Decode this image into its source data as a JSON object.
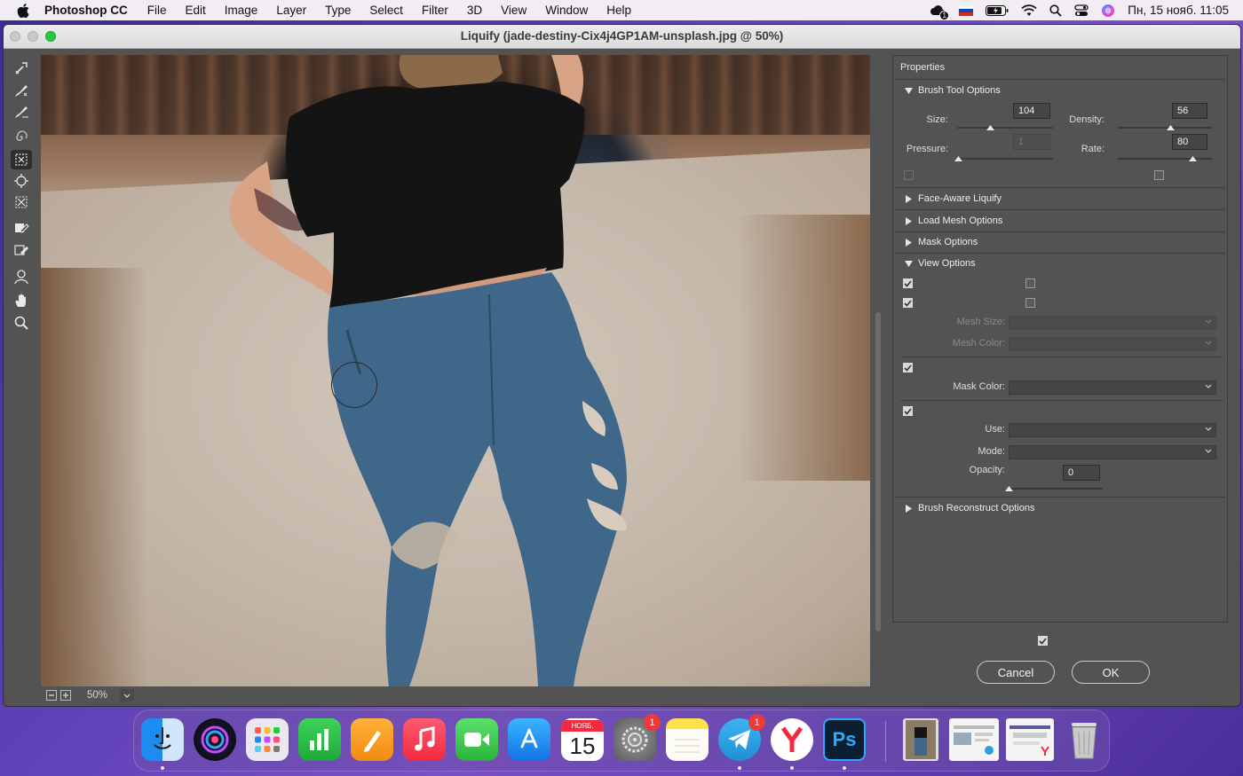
{
  "menubar": {
    "app_name": "Photoshop CC",
    "items": [
      "File",
      "Edit",
      "Image",
      "Layer",
      "Type",
      "Select",
      "Filter",
      "3D",
      "View",
      "Window",
      "Help"
    ],
    "notification_badge": "1",
    "clock": "Пн, 15 нояб.  11:05"
  },
  "window": {
    "title": "Liquify (jade-destiny-Cix4j4GP1AM-unsplash.jpg @ 50%)"
  },
  "status": {
    "zoom": "50%"
  },
  "panel": {
    "title": "Properties",
    "brush_tool_options": {
      "label": "Brush Tool Options",
      "size_label": "Size:",
      "size_value": "104",
      "size_level": 0.35,
      "density_label": "Density:",
      "density_value": "56",
      "density_level": 0.56,
      "pressure_label": "Pressure:",
      "pressure_value": "1",
      "pressure_level": 0.01,
      "rate_label": "Rate:",
      "rate_value": "80",
      "rate_level": 0.8
    },
    "sections": {
      "face_aware": "Face-Aware Liquify",
      "load_mesh": "Load Mesh Options",
      "mask_options": "Mask Options",
      "view_options": "View Options",
      "brush_reconstruct": "Brush Reconstruct Options"
    },
    "view_options": {
      "mesh_size_label": "Mesh Size:",
      "mesh_color_label": "Mesh Color:",
      "mask_color_label": "Mask Color:",
      "use_label": "Use:",
      "mode_label": "Mode:",
      "opacity_label": "Opacity:",
      "opacity_value": "0",
      "opacity_level": 0.0
    }
  },
  "buttons": {
    "cancel": "Cancel",
    "ok": "OK"
  },
  "dock": {
    "calendar_month": "НОЯБ.",
    "calendar_day": "15",
    "settings_badge": "1",
    "telegram_badge": "1",
    "photoshop_label": "Ps"
  }
}
